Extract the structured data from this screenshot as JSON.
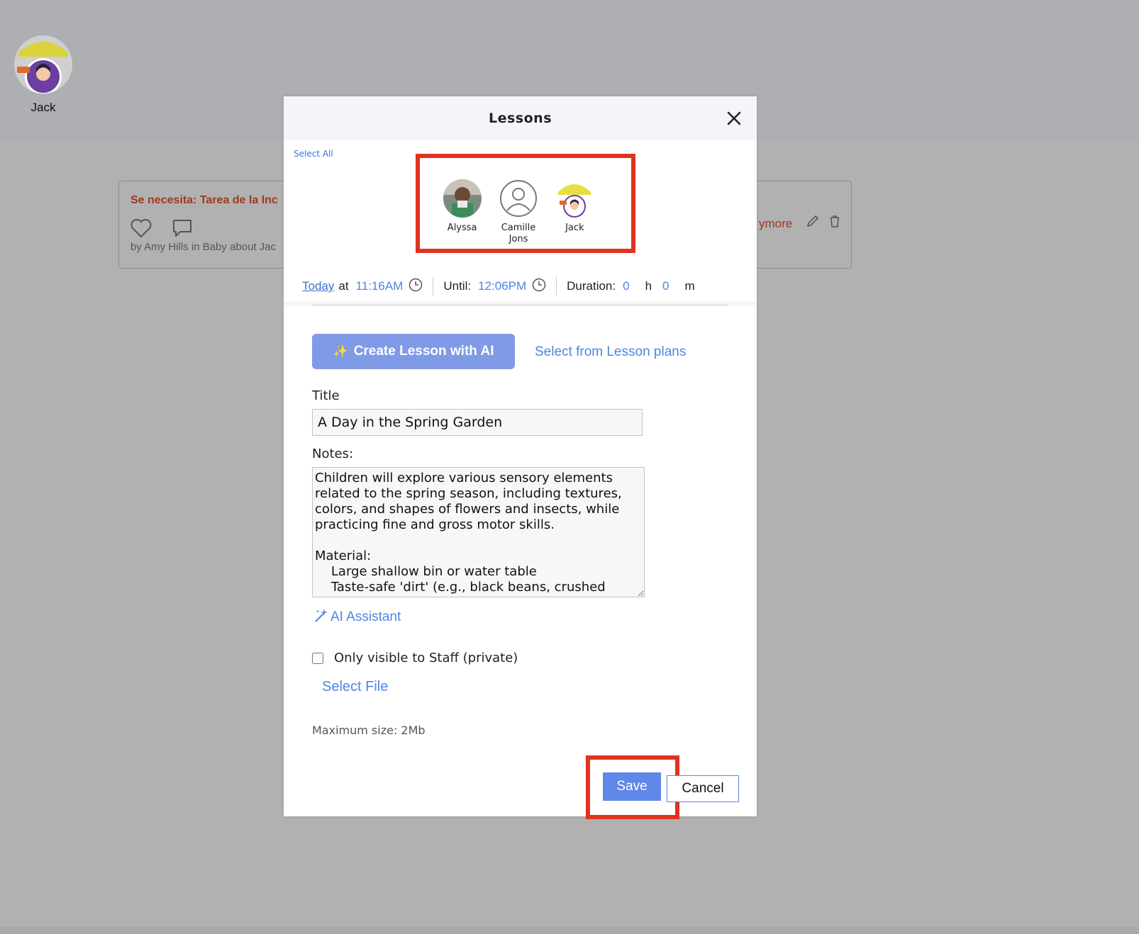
{
  "background": {
    "profile": {
      "name": "Jack"
    },
    "feed_item": {
      "title": "Se necesita: Tarea de la Inc",
      "byline": "by Amy Hills in Baby about Jac",
      "more_link": "ymore"
    }
  },
  "modal": {
    "title": "Lessons",
    "select_all": "Select All",
    "recipients": [
      {
        "name": "Alyssa"
      },
      {
        "name": "Camille Jons"
      },
      {
        "name": "Jack"
      }
    ],
    "schedule": {
      "date": "Today",
      "at": "at",
      "start_time": "11:16AM",
      "until_label": "Until:",
      "end_time": "12:06PM",
      "duration_label": "Duration:",
      "hours": "0",
      "hours_unit": "h",
      "minutes": "0",
      "minutes_unit": "m"
    },
    "ai_button": "Create Lesson with AI",
    "plans_link": "Select from Lesson plans",
    "title_label": "Title",
    "title_value": "A Day in the Spring Garden",
    "notes_label": "Notes:",
    "notes_value": "Children will explore various sensory elements related to the spring season, including textures, colors, and shapes of flowers and insects, while practicing fine and gross motor skills.\n\nMaterial:\n    Large shallow bin or water table\n    Taste-safe 'dirt' (e.g., black beans, crushed",
    "ai_assistant": "AI Assistant",
    "private_label": "Only visible to Staff (private)",
    "private_checked": false,
    "select_file": "Select File",
    "max_size": "Maximum size: 2Mb",
    "save": "Save",
    "cancel": "Cancel"
  },
  "colors": {
    "accent": "#4d86e0",
    "primary_button": "#5f88e8",
    "ai_button": "#7f9ae6",
    "highlight": "#e0331f",
    "brand_red": "#a0391f"
  }
}
